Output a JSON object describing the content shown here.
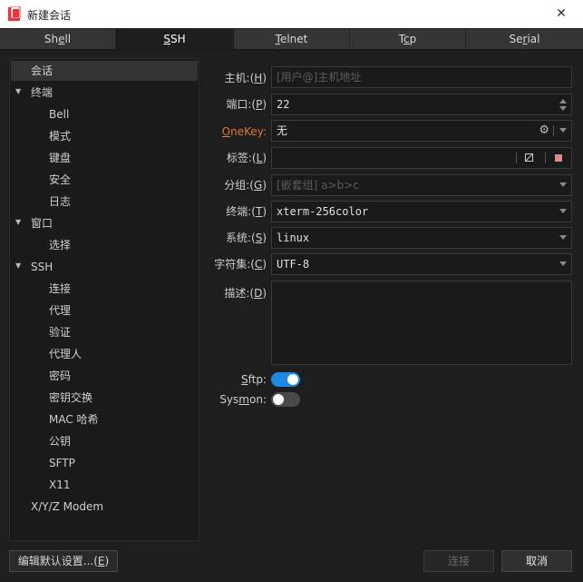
{
  "window": {
    "title": "新建会话",
    "close_glyph": "✕",
    "icon_color": "#e8343a"
  },
  "tabs": [
    {
      "label": "Shell",
      "active": false
    },
    {
      "label": "SSH",
      "active": true
    },
    {
      "label": "Telnet",
      "active": false
    },
    {
      "label": "Tcp",
      "active": false
    },
    {
      "label": "Serial",
      "active": false
    }
  ],
  "tree": {
    "session": "会话",
    "terminal": "终端",
    "bell": "Bell",
    "mode": "模式",
    "keyboard": "键盘",
    "security": "安全",
    "log": "日志",
    "window": "窗口",
    "selection": "选择",
    "ssh": "SSH",
    "connection": "连接",
    "proxy": "代理",
    "auth": "验证",
    "agent": "代理人",
    "password": "密码",
    "kex": "密钥交换",
    "mac": "MAC 哈希",
    "pubkey": "公钥",
    "sftp": "SFTP",
    "x11": "X11",
    "modem": "X/Y/Z Modem"
  },
  "form": {
    "host": {
      "label": "主机:(H)",
      "placeholder": "[用户@]主机地址",
      "value": ""
    },
    "port": {
      "label": "端口:(P)",
      "value": "22"
    },
    "onekey": {
      "label": "OneKey:",
      "value": "无"
    },
    "tags": {
      "label": "标签:(L)",
      "value": ""
    },
    "group": {
      "label": "分组:(G)",
      "placeholder": "[嵌套组] a>b>c"
    },
    "terminal": {
      "label": "终端:(T)",
      "value": "xterm-256color"
    },
    "system": {
      "label": "系统:(S)",
      "value": "linux"
    },
    "charset": {
      "label": "字符集:(C)",
      "value": "UTF-8"
    },
    "description": {
      "label": "描述:(D)",
      "value": ""
    },
    "sftp": {
      "label": "Sftp:",
      "enabled": true
    },
    "sysmon": {
      "label": "Sysmon:",
      "enabled": false
    }
  },
  "buttons": {
    "edit_defaults": "编辑默认设置...(E)",
    "connect": "连接",
    "cancel": "取消"
  },
  "colors": {
    "accent": "#e0763a",
    "toggle_on": "#1e88e5",
    "toggle_off": "#4a4a4a"
  }
}
